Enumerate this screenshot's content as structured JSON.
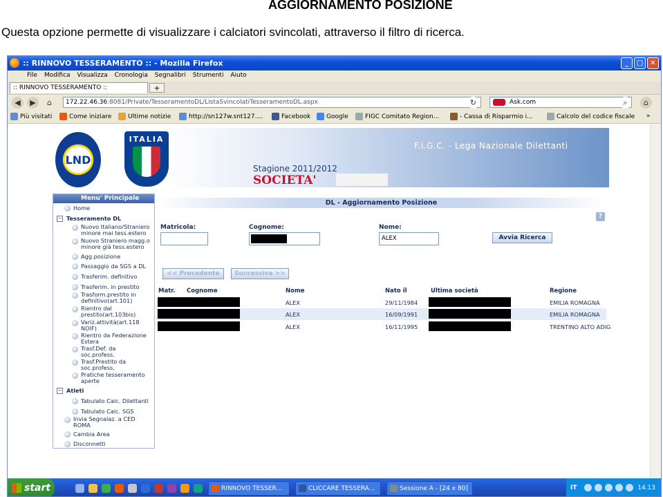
{
  "doc": {
    "title": "AGGIORNAMENTO POSIZIONE",
    "intro": "Questa opzione permette di visualizzare i calciatori svincolati, attraverso il filtro di ricerca."
  },
  "browser": {
    "window_title": ":: RINNOVO TESSERAMENTO :: - Mozilla Firefox",
    "menu": [
      "File",
      "Modifica",
      "Visualizza",
      "Cronologia",
      "Segnalibri",
      "Strumenti",
      "Aiuto"
    ],
    "tab_label": ":: RINNOVO TESSERAMENTO ::",
    "tab_add": "+",
    "url_host": "172.22.46.36",
    "url_path": ":8081/Private/TesseramentoDL/ListaSvincolatiTesseramentoDL.aspx",
    "search_value": "Ask.com",
    "bookmarks": [
      "Più visitati",
      "Come iniziare",
      "Ultime notizie",
      "http://sn127w.snt127....",
      "Facebook",
      "Google",
      "FIGC Comitato Region...",
      "- Cassa di Risparmio i...",
      "Calcolo del codice fiscale"
    ],
    "bookmarks_more": "»"
  },
  "site": {
    "logo_lnd": "LND",
    "logo_italia": "ITALIA",
    "header_title": "F.I.G.C. - Lega Nazionale Dilettanti",
    "stagione": "Stagione 2011/2012",
    "societa": "SOCIETA'"
  },
  "sidebar": {
    "title": "Menu' Principale",
    "items": [
      {
        "label": "Home"
      },
      {
        "label": "Tesseramento DL"
      },
      {
        "label": "Nuovo Italiano/Straniero minore mai tess.estero"
      },
      {
        "label": "Nuovo Straniero magg.o minore già tess.estero"
      },
      {
        "label": "Agg.posizione"
      },
      {
        "label": "Passaggio da SGS a DL"
      },
      {
        "label": "Trasferim. definitivo"
      },
      {
        "label": "Trasferim. in prestito"
      },
      {
        "label": "Trasform.prestito in definitivo(art.101)"
      },
      {
        "label": "Rientro dal prestito(art.103bis)"
      },
      {
        "label": "Variz.attività(art.118 NOIF)"
      },
      {
        "label": "Rientro da Federazione Estera"
      },
      {
        "label": "Trasf.Def. da soc.profess."
      },
      {
        "label": "Trasf.Prestito da soc.profess."
      },
      {
        "label": "Pratiche tesseramento aperte"
      },
      {
        "label": "Atleti"
      },
      {
        "label": "Tabulato Calc. Dilettanti"
      },
      {
        "label": "Tabulato Calc. SGS"
      },
      {
        "label": "Invia Segnalaz. a CED ROMA"
      },
      {
        "label": "Cambia Area"
      },
      {
        "label": "Disconnetti"
      }
    ]
  },
  "panel": {
    "title": "DL - Aggiornamento Posizione",
    "help": "?",
    "labels": {
      "matricola": "Matricola:",
      "cognome": "Cognome:",
      "nome": "Nome:"
    },
    "values": {
      "matricola": "",
      "nome": "ALEX"
    },
    "search_button": "Avvia Ricerca",
    "prev_button": "<< Precedente",
    "next_button": "Successiva >>",
    "columns": [
      "Matr.",
      "Cognome",
      "Nome",
      "Nato il",
      "Ultima società",
      "Regione"
    ],
    "rows": [
      {
        "nome": "ALEX",
        "nato": "29/11/1984",
        "regione": "EMILIA ROMAGNA"
      },
      {
        "nome": "ALEX",
        "nato": "16/09/1991",
        "regione": "EMILIA ROMAGNA"
      },
      {
        "nome": "ALEX",
        "nato": "16/11/1995",
        "regione": "TRENTINO ALTO ADIG"
      }
    ]
  },
  "taskbar": {
    "start": "start",
    "items": [
      "RINNOVO TESSER...",
      "CLICCARE TESSERA...",
      "Sessione A - [24 x 80]"
    ],
    "lang": "IT",
    "clock": "14.13"
  }
}
